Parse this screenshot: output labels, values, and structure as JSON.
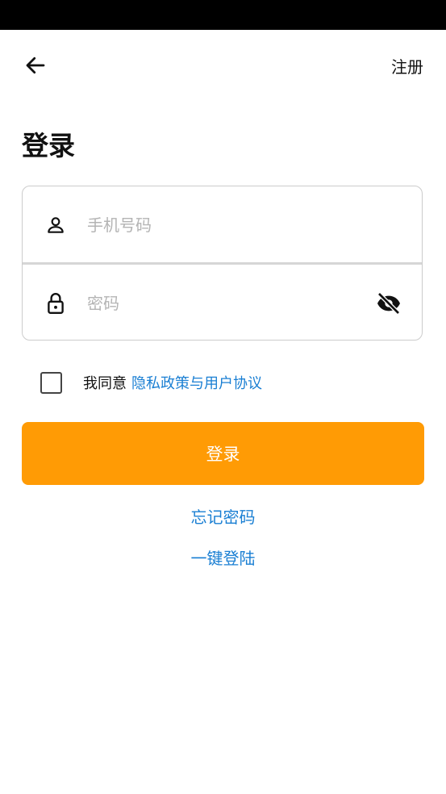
{
  "header": {
    "register_label": "注册"
  },
  "page": {
    "title": "登录"
  },
  "form": {
    "phone_placeholder": "手机号码",
    "password_placeholder": "密码"
  },
  "agreement": {
    "prefix": "我同意",
    "link": "隐私政策与用户协议",
    "checked": false
  },
  "actions": {
    "login_label": "登录",
    "forgot_label": "忘记密码",
    "quick_login_label": "一键登陆"
  },
  "colors": {
    "accent": "#ff9b05",
    "link": "#1a7fd3",
    "status_bar": "#000000"
  },
  "icons": {
    "back": "arrow-left-icon",
    "phone": "person-icon",
    "password": "lock-icon",
    "visibility": "eye-off-icon"
  }
}
